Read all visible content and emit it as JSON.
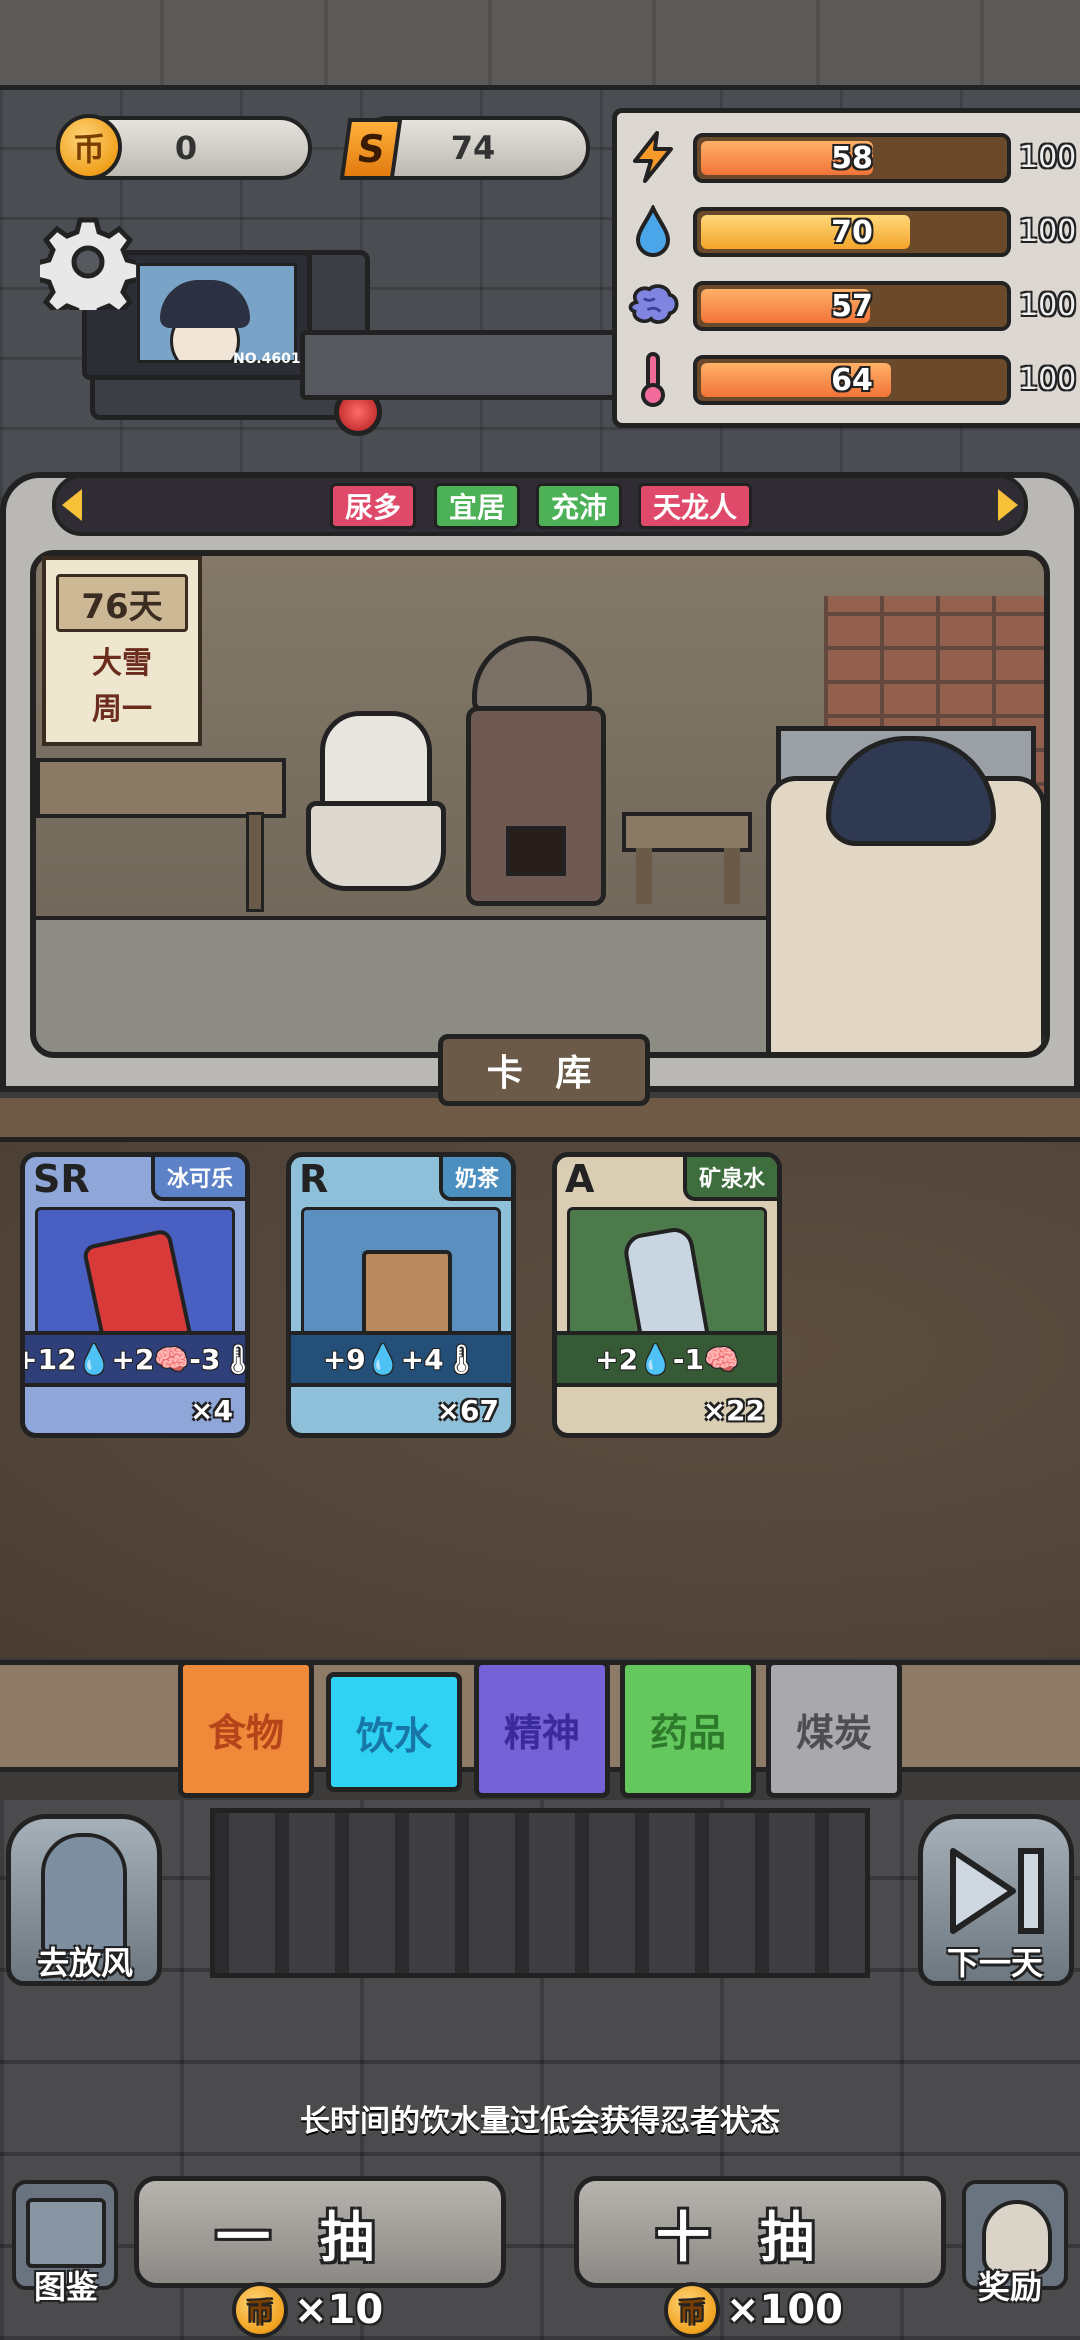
{
  "currencies": {
    "coins": "0",
    "special": "74"
  },
  "currency_icons": {
    "coin_glyph": "币",
    "special_glyph": "S"
  },
  "stats": {
    "energy": {
      "value": 58,
      "label": "58",
      "max": "100",
      "icon": "lightning-icon",
      "color": "#f58a3c"
    },
    "water": {
      "value": 70,
      "label": "70",
      "max": "100",
      "icon": "water-drop-icon",
      "color": "#f3a52b"
    },
    "mind": {
      "value": 57,
      "label": "57",
      "max": "100",
      "icon": "brain-icon",
      "color": "#f58a3c"
    },
    "warmth": {
      "value": 64,
      "label": "64",
      "max": "100",
      "icon": "thermometer-icon",
      "color": "#f58a3c"
    }
  },
  "avatar": {
    "id_text": "NO.4601"
  },
  "traits": [
    "尿多",
    "宜居",
    "充沛",
    "天龙人"
  ],
  "calendar": {
    "days": "76天",
    "weather": "大雪",
    "weekday": "周一"
  },
  "library_title": "卡 库",
  "cards": [
    {
      "rank": "SR",
      "name": "冰可乐",
      "effects": "+12💧+2🧠-3🌡",
      "count": "×4",
      "frame": "#8ea6d8",
      "tag": "#5e82c8",
      "strip": "#2e3f7a"
    },
    {
      "rank": "R",
      "name": "奶茶",
      "effects": "+9💧+4🌡",
      "count": "×67",
      "frame": "#8fc0da",
      "tag": "#4a8fbf",
      "strip": "#234f78"
    },
    {
      "rank": "A",
      "name": "矿泉水",
      "effects": "+2💧-1🧠",
      "count": "×22",
      "frame": "#d9cdb4",
      "tag": "#3f6e3e",
      "strip": "#375a36"
    }
  ],
  "categories": [
    {
      "label": "食物",
      "bg": "#f08a3a",
      "fg": "#b5441a",
      "active": false
    },
    {
      "label": "饮水",
      "bg": "#2fd2f3",
      "fg": "#1777a6",
      "active": true
    },
    {
      "label": "精神",
      "bg": "#7462d6",
      "fg": "#3b2b9a",
      "active": false
    },
    {
      "label": "药品",
      "bg": "#64c85e",
      "fg": "#2c7a2a",
      "active": false
    },
    {
      "label": "煤炭",
      "bg": "#a9a9ad",
      "fg": "#4d4d52",
      "active": false
    }
  ],
  "buttons": {
    "go_out": "去放风",
    "next_day": "下一天",
    "draw_one": "一抽",
    "draw_ten": "十抽",
    "draw_one_cost": "×10",
    "draw_ten_cost": "×100",
    "catalog": "图鉴",
    "reward": "奖励"
  },
  "hint": "长时间的饮水量过低会获得忍者状态"
}
